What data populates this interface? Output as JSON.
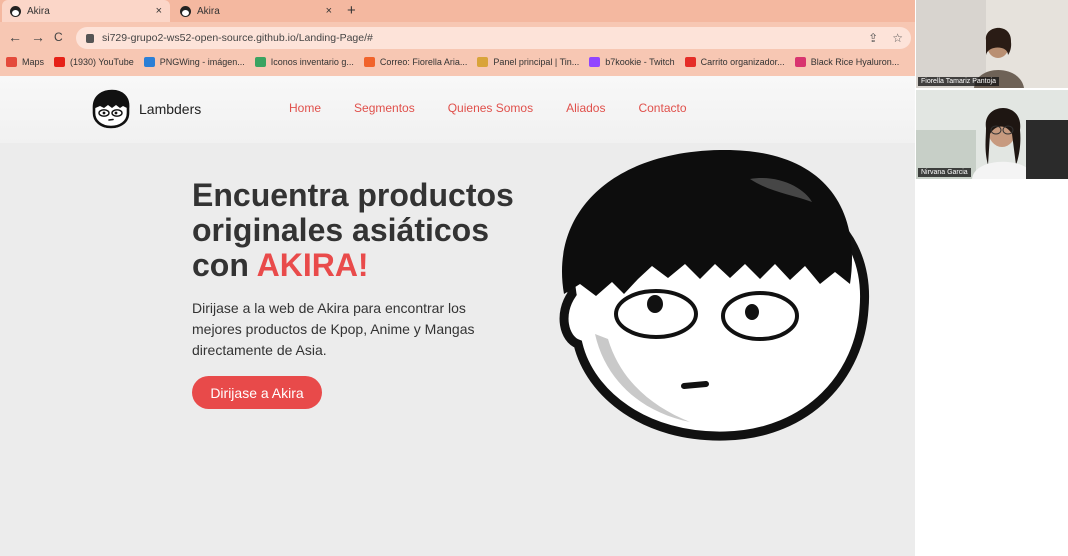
{
  "browser": {
    "tabs": [
      {
        "title": "Akira",
        "active": true
      },
      {
        "title": "Akira",
        "active": false
      }
    ],
    "close_glyph": "×",
    "new_tab_glyph": "+",
    "nav": {
      "back": "←",
      "forward": "→",
      "reload": "C"
    },
    "url": "si729-grupo2-ws52-open-source.github.io/Landing-Page/#",
    "bookmarks": [
      {
        "label": "Maps",
        "icon": "maps-pin-icon",
        "color": "#e44a3b"
      },
      {
        "label": "(1930) YouTube",
        "icon": "youtube-icon",
        "color": "#e62117"
      },
      {
        "label": "PNGWing - imágen...",
        "icon": "pngwing-icon",
        "color": "#2b7fd6"
      },
      {
        "label": "Iconos inventario g...",
        "icon": "triangle-icon",
        "color": "#3aa361"
      },
      {
        "label": "Correo: Fiorella Aria...",
        "icon": "office-icon",
        "color": "#f1632b"
      },
      {
        "label": "Panel principal | Tin...",
        "icon": "grid-icon",
        "color": "#d9a43a"
      },
      {
        "label": "b7kookie - Twitch",
        "icon": "twitch-icon",
        "color": "#9146ff"
      },
      {
        "label": "Carrito organizador...",
        "icon": "store-icon",
        "color": "#e52d27"
      },
      {
        "label": "Black Rice Hyaluron...",
        "icon": "b-brand-icon",
        "color": "#d8356f"
      }
    ]
  },
  "site": {
    "brand": "Lambders",
    "nav": [
      "Home",
      "Segmentos",
      "Quienes Somos",
      "Aliados",
      "Contacto"
    ],
    "hero": {
      "title_main": "Encuentra productos originales asiáticos con ",
      "title_accent": "AKIRA!",
      "text": "Dirijase a la web de Akira para encontrar los mejores productos de Kpop, Anime y Mangas directamente de Asia.",
      "button": "Dirijase a Akira"
    },
    "colors": {
      "accent": "#e94b4b",
      "nav": "#e0504b"
    }
  },
  "call": {
    "participants": [
      "Fiorella Tamariz Pantoja",
      "Nirvana Garcia"
    ]
  }
}
